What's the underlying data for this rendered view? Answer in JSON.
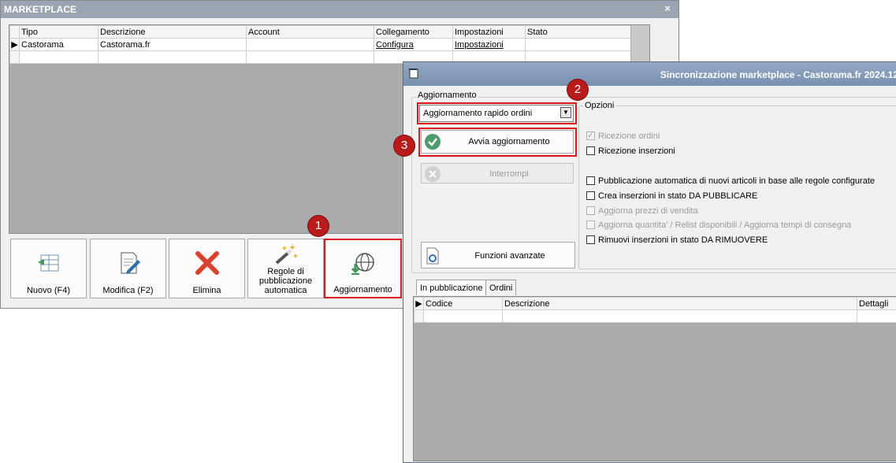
{
  "main_window": {
    "title": "MARKETPLACE",
    "close_glyph": "×",
    "grid": {
      "columns": [
        "Tipo",
        "Descrizione",
        "Account",
        "Collegamento",
        "Impostazioni",
        "Stato"
      ],
      "rows": [
        {
          "tipo": "Castorama",
          "descrizione": "Castorama.fr",
          "account": "",
          "collegamento": "Configura",
          "impostazioni": "Impostazioni",
          "stato": ""
        }
      ]
    },
    "buttons": [
      {
        "label": "Nuovo (F4)",
        "icon": "new-table-icon"
      },
      {
        "label": "Modifica (F2)",
        "icon": "edit-document-icon"
      },
      {
        "label": "Elimina",
        "icon": "delete-x-icon"
      },
      {
        "label": "Regole di\npubblicazione\nautomatica",
        "icon": "magic-wand-icon"
      },
      {
        "label": "Aggiornamento",
        "icon": "globe-download-icon"
      }
    ]
  },
  "badges": {
    "one": "1",
    "two": "2",
    "three": "3"
  },
  "sync_dialog": {
    "title": "Sincronizzazione marketplace - Castorama.fr 2024.12",
    "aggiornamento_group": "Aggiornamento",
    "combo_value": "Aggiornamento rapido ordini",
    "start_button": "Avvia aggiornamento",
    "stop_button": "Interrompi",
    "advanced_button": "Funzioni avanzate",
    "options_group": "Opzioni",
    "options": [
      {
        "label": "Ricezione ordini",
        "checked": true,
        "enabled": false
      },
      {
        "label": "Ricezione inserzioni",
        "checked": false,
        "enabled": true
      },
      {
        "label": "Pubblicazione automatica di nuovi articoli in base alle regole configurate",
        "checked": false,
        "enabled": true
      },
      {
        "label": "Crea inserzioni in stato DA PUBBLICARE",
        "checked": false,
        "enabled": true
      },
      {
        "label": "Aggiorna prezzi di vendita",
        "checked": false,
        "enabled": false
      },
      {
        "label": "Aggiorna quantita' / Relist disponibili / Aggiorna tempi di consegna",
        "checked": false,
        "enabled": false
      },
      {
        "label": "Rimuovi inserzioni in stato DA RIMUOVERE",
        "checked": false,
        "enabled": true
      }
    ],
    "tabs": [
      "In pubblicazione",
      "Ordini"
    ],
    "grid_columns": [
      "Codice",
      "Descrizione",
      "Dettagli"
    ],
    "colors": {
      "accent_red": "#e0141c",
      "badge_red": "#b81b1b",
      "check_green": "#4a9d6a"
    }
  }
}
